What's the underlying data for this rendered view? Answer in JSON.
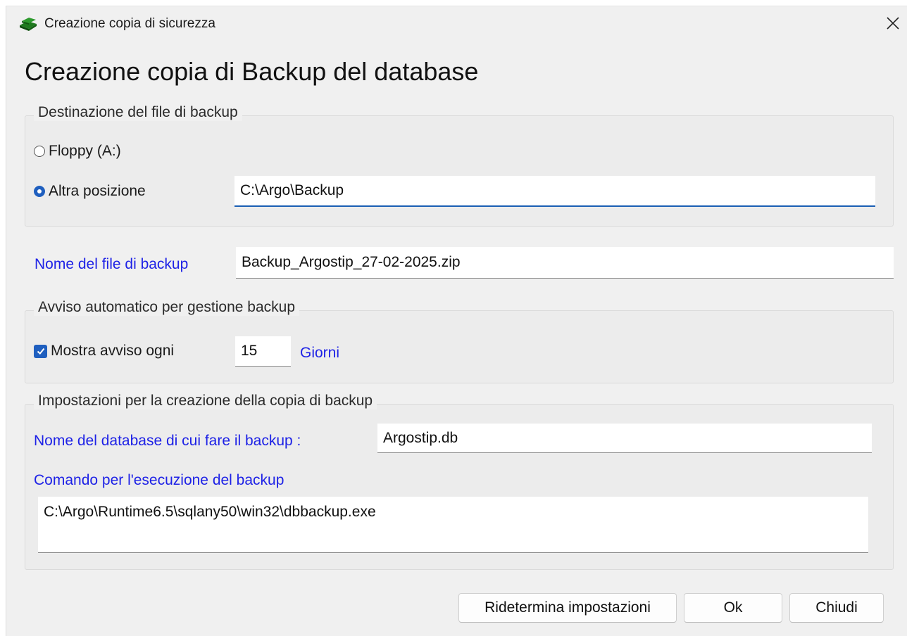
{
  "window": {
    "title": "Creazione copia di sicurezza"
  },
  "heading": "Creazione copia di Backup del database",
  "destination": {
    "legend": "Destinazione del file di backup",
    "floppy_label": "Floppy (A:)",
    "other_label": "Altra posizione",
    "selected": "Altra posizione",
    "path_value": "C:\\Argo\\Backup"
  },
  "filename": {
    "label": "Nome del file di backup",
    "value": "Backup_Argostip_27-02-2025.zip"
  },
  "reminder": {
    "legend": "Avviso automatico per gestione backup",
    "checkbox_label": "Mostra avviso ogni",
    "checked": true,
    "days_value": "15",
    "days_unit": "Giorni"
  },
  "settings": {
    "legend": "Impostazioni per la creazione della copia di backup",
    "db_label": "Nome del database di cui fare il backup :",
    "db_value": "Argostip.db",
    "command_label": "Comando per l'esecuzione del backup",
    "command_value": "C:\\Argo\\Runtime6.5\\sqlany50\\win32\\dbbackup.exe"
  },
  "buttons": {
    "reset": "Ridetermina impostazioni",
    "ok": "Ok",
    "close": "Chiudi"
  },
  "colors": {
    "label_blue": "#1e22e6",
    "accent": "#1f5fbf"
  }
}
